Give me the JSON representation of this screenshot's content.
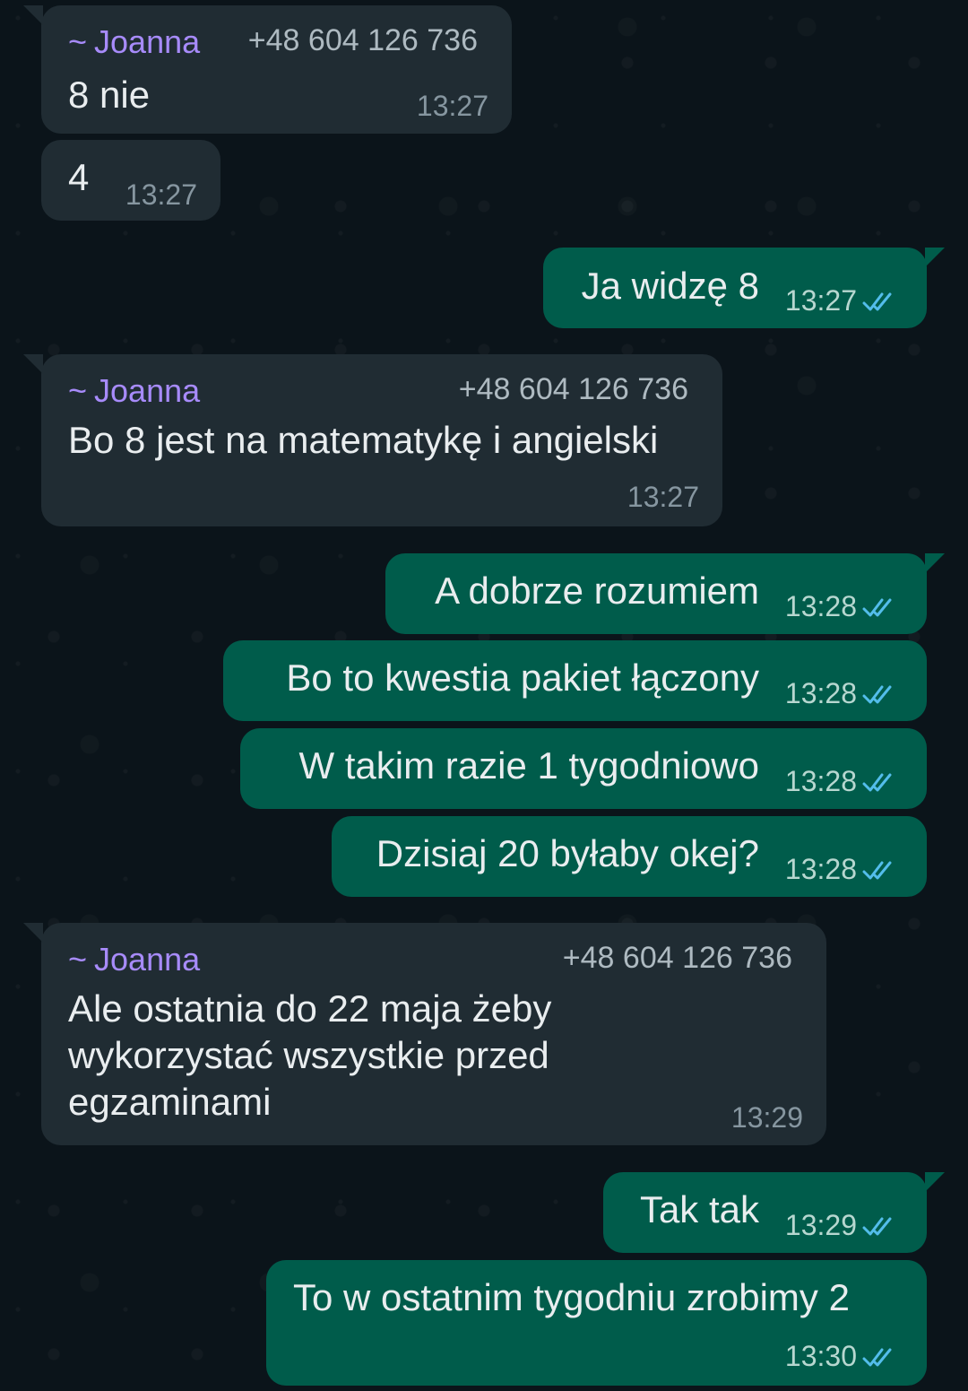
{
  "contact": {
    "name": "Joanna",
    "tilde": "~",
    "phone": "+48 604 126 736"
  },
  "colors": {
    "wallpaper": "#0b141a",
    "incoming_bubble": "#202c33",
    "outgoing_bubble": "#005c4b",
    "sender_name": "#a78bfa",
    "read_ticks": "#53bdeb"
  },
  "messages": [
    {
      "direction": "in",
      "sender": "Joanna",
      "phone": "+48 604 126 736",
      "text": "8 nie",
      "time": "13:27"
    },
    {
      "direction": "in",
      "text": "4",
      "time": "13:27"
    },
    {
      "direction": "out",
      "text": "Ja widzę 8",
      "time": "13:27",
      "status": "read-double-check"
    },
    {
      "direction": "in",
      "sender": "Joanna",
      "phone": "+48 604 126 736",
      "text": "Bo 8 jest na matematykę i angielski",
      "time": "13:27"
    },
    {
      "direction": "out",
      "text": "A dobrze rozumiem",
      "time": "13:28",
      "status": "read-double-check"
    },
    {
      "direction": "out",
      "text": "Bo to kwestia pakiet łączony",
      "time": "13:28",
      "status": "read-double-check"
    },
    {
      "direction": "out",
      "text": "W takim razie 1 tygodniowo",
      "time": "13:28",
      "status": "read-double-check"
    },
    {
      "direction": "out",
      "text": "Dzisiaj 20 byłaby okej?",
      "time": "13:28",
      "status": "read-double-check"
    },
    {
      "direction": "in",
      "sender": "Joanna",
      "phone": "+48 604 126 736",
      "text": "Ale ostatnia do 22 maja żeby\nwykorzystać wszystkie przed\negzaminami",
      "time": "13:29"
    },
    {
      "direction": "out",
      "text": "Tak tak",
      "time": "13:29",
      "status": "read-double-check"
    },
    {
      "direction": "out",
      "text": "To w ostatnim tygodniu zrobimy 2",
      "time": "13:30",
      "status": "read-double-check"
    }
  ]
}
